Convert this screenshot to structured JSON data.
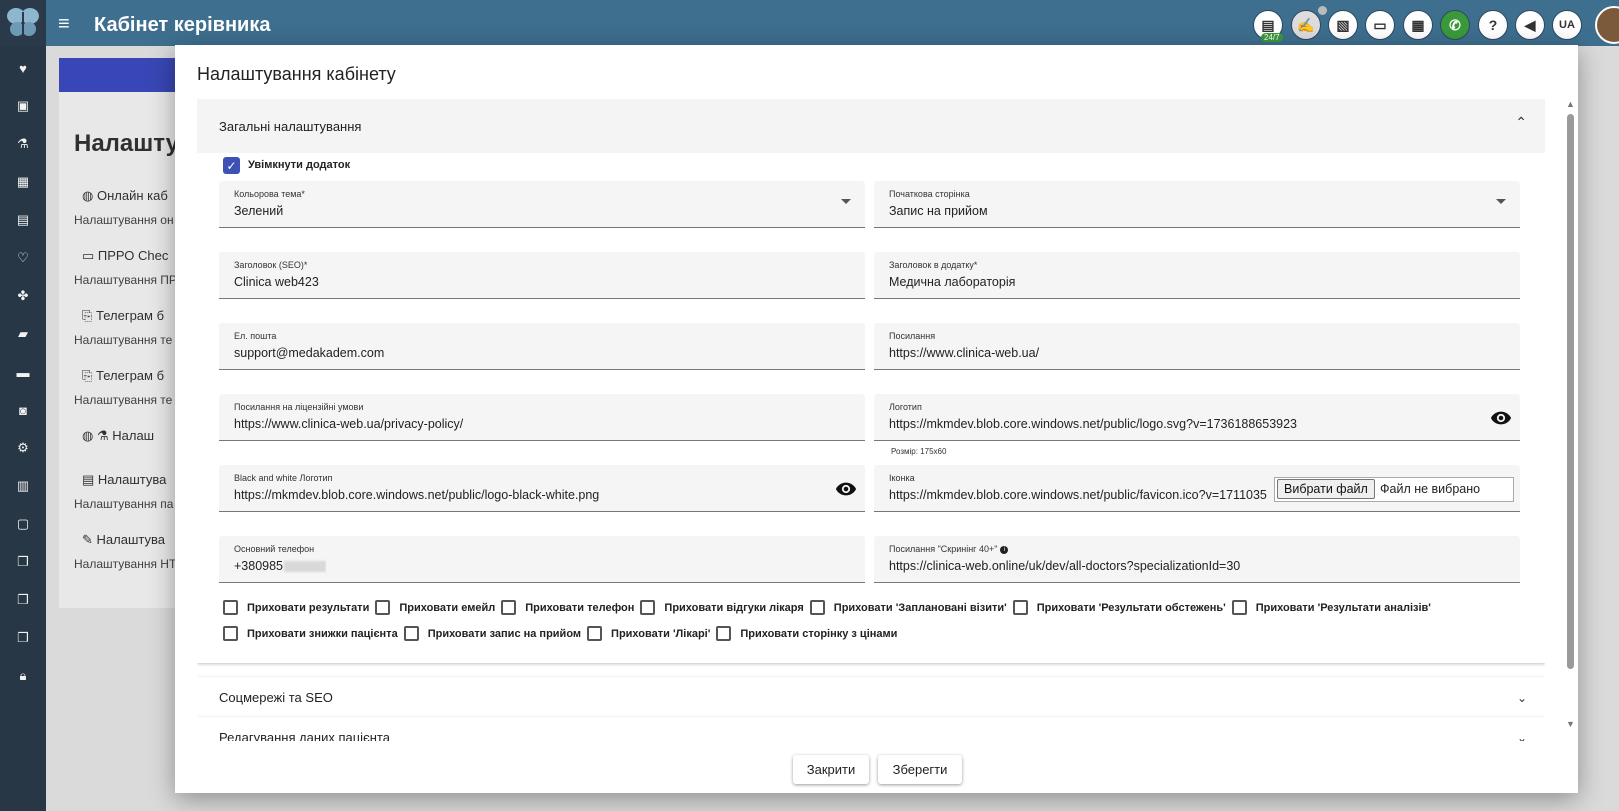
{
  "header": {
    "title": "Кабінет керівника",
    "support_badge": "24/7",
    "lang_label": "UA"
  },
  "background": {
    "heading": "Налашту",
    "rows": [
      {
        "title": "Онлайн каб",
        "subtitle": "Налаштування он"
      },
      {
        "title": "ПРРО Chec",
        "subtitle": "Налаштування ПР"
      },
      {
        "title": "Телеграм б",
        "subtitle": "Налаштування те"
      },
      {
        "title": "Телеграм б",
        "subtitle": "Налаштування те"
      },
      {
        "title": "Налаш",
        "subtitle": ""
      },
      {
        "title": "Налаштува",
        "subtitle": "Налаштування па"
      },
      {
        "title": "Налаштува",
        "subtitle": "Налаштування НТ"
      }
    ]
  },
  "modal": {
    "title": "Налаштування кабінету",
    "general": {
      "title": "Загальні налаштування",
      "enable_label": "Увімкнути додаток",
      "fields": {
        "theme": {
          "label": "Кольорова тема*",
          "value": "Зелений"
        },
        "start_page": {
          "label": "Початкова сторінка",
          "value": "Запис на прийом"
        },
        "seo_title": {
          "label": "Заголовок (SEO)*",
          "value": "Clinica web423"
        },
        "app_title": {
          "label": "Заголовок в додатку*",
          "value": "Медична лабораторія"
        },
        "email": {
          "label": "Ел. пошта",
          "value": "support@medakadem.com"
        },
        "link": {
          "label": "Посилання",
          "value": "https://www.clinica-web.ua/"
        },
        "license_link": {
          "label": "Посилання на ліцензійні умови",
          "value": "https://www.clinica-web.ua/privacy-policy/"
        },
        "logo": {
          "label": "Логотип",
          "value": "https://mkmdev.blob.core.windows.net/public/logo.svg?v=1736188653923",
          "hint": "Розмір: 175x60"
        },
        "bw_logo": {
          "label": "Black and white Логотип",
          "value": "https://mkmdev.blob.core.windows.net/public/logo-black-white.png"
        },
        "favicon": {
          "label": "Іконка",
          "value": "https://mkmdev.blob.core.windows.net/public/favicon.ico?v=1711035",
          "file_button": "Вибрати файл",
          "file_status": "Файл не вибрано"
        },
        "phone": {
          "label": "Основний телефон",
          "value": "+380985"
        },
        "screening_link": {
          "label": "Посилання \"Скринінг 40+\"",
          "value": "https://clinica-web.online/uk/dev/all-doctors?specializationId=30"
        }
      },
      "checkboxes_row1": [
        "Приховати результати",
        "Приховати емейл",
        "Приховати телефон",
        "Приховати відгуки лікаря",
        "Приховати 'Заплановані візити'",
        "Приховати 'Результати обстежень'",
        "Приховати 'Результати аналізів'"
      ],
      "checkboxes_row2": [
        "Приховати знижки пацієнта",
        "Приховати запис на прийом",
        "Приховати 'Лікарі'",
        "Приховати сторінку з цінами"
      ]
    },
    "sections": [
      {
        "title": "Соцмережі та SEO"
      },
      {
        "title": "Редагування даних пацієнта"
      }
    ],
    "buttons": {
      "close": "Закрити",
      "save": "Зберегти"
    }
  },
  "colors": {
    "header_bg": "#3e6f8f",
    "sidebar_bg": "#2a3a4a",
    "checkbox_accent": "#3f51b5",
    "phone_green": "#3a9a3a"
  }
}
